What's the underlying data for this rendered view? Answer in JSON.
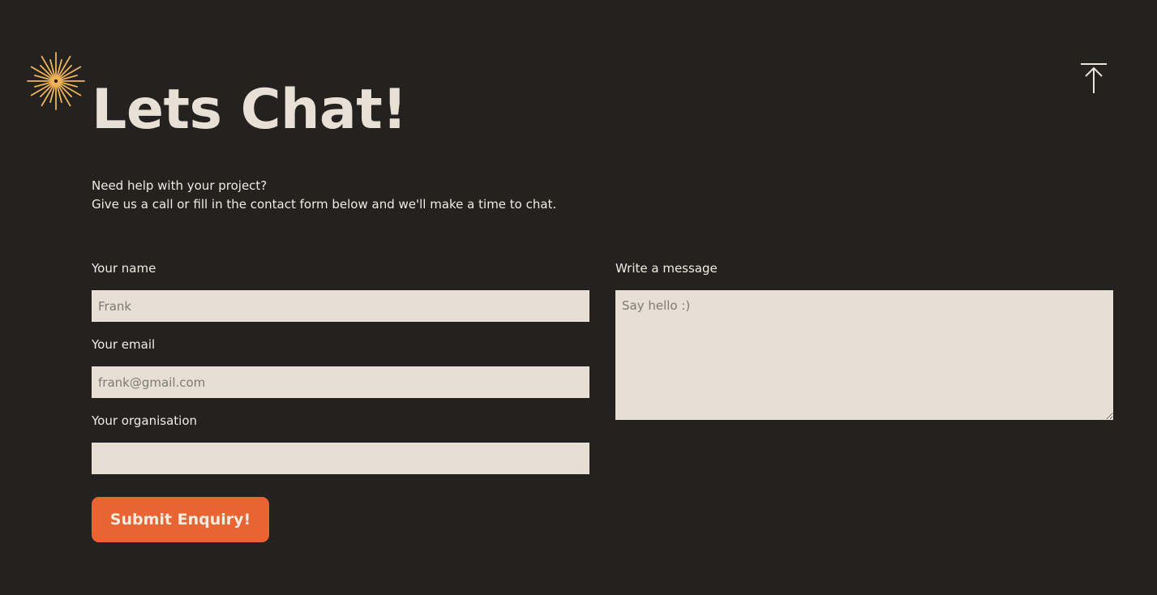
{
  "header": {
    "title": "Lets Chat!",
    "decoration_icon": "sunburst-icon",
    "back_to_top_icon": "arrow-up-to-line-icon"
  },
  "intro": {
    "line1": "Need help with your project?",
    "line2": "Give us a call or fill in the contact form below and we'll make a time to chat."
  },
  "form": {
    "name": {
      "label": "Your name",
      "placeholder": "Frank",
      "value": ""
    },
    "email": {
      "label": "Your email",
      "placeholder": "frank@gmail.com",
      "value": ""
    },
    "organisation": {
      "label": "Your organisation",
      "placeholder": "",
      "value": ""
    },
    "message": {
      "label": "Write a message",
      "placeholder": "Say hello :)",
      "value": ""
    },
    "submit_label": "Submit Enquiry!"
  },
  "colors": {
    "background": "#232221",
    "accent": "#e86432",
    "sunburst": "#f0b457",
    "input_bg": "#e7dfd4",
    "text": "#f1ebe2"
  }
}
